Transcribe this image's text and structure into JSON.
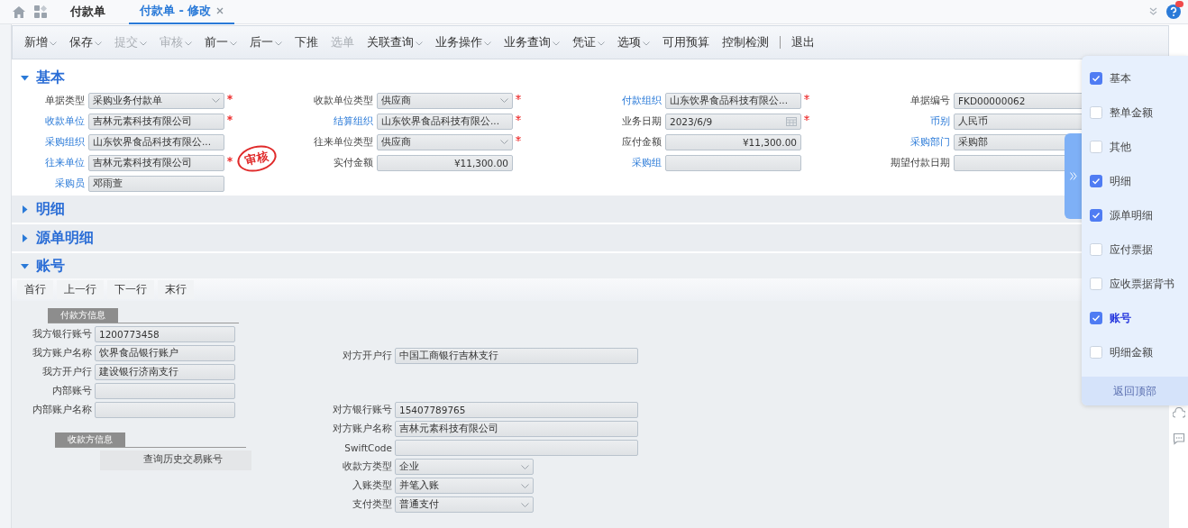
{
  "tabs": [
    {
      "label": "付款单",
      "selected": false,
      "closable": false
    },
    {
      "label": "付款单 - 修改",
      "selected": true,
      "closable": true
    }
  ],
  "toolbar": [
    {
      "kind": "item",
      "label": "新增",
      "menu": true,
      "disabled": false
    },
    {
      "kind": "item",
      "label": "保存",
      "menu": true,
      "disabled": false
    },
    {
      "kind": "item",
      "label": "提交",
      "menu": true,
      "disabled": true
    },
    {
      "kind": "item",
      "label": "审核",
      "menu": true,
      "disabled": true
    },
    {
      "kind": "item",
      "label": "前一",
      "menu": true,
      "disabled": false
    },
    {
      "kind": "item",
      "label": "后一",
      "menu": true,
      "disabled": false
    },
    {
      "kind": "item",
      "label": "下推",
      "menu": false,
      "disabled": false
    },
    {
      "kind": "item",
      "label": "选单",
      "menu": false,
      "disabled": true
    },
    {
      "kind": "item",
      "label": "关联查询",
      "menu": true,
      "disabled": false
    },
    {
      "kind": "item",
      "label": "业务操作",
      "menu": true,
      "disabled": false
    },
    {
      "kind": "item",
      "label": "业务查询",
      "menu": true,
      "disabled": false
    },
    {
      "kind": "item",
      "label": "凭证",
      "menu": true,
      "disabled": false
    },
    {
      "kind": "item",
      "label": "选项",
      "menu": true,
      "disabled": false
    },
    {
      "kind": "item",
      "label": "可用预算",
      "menu": false,
      "disabled": false
    },
    {
      "kind": "item",
      "label": "控制检测",
      "menu": false,
      "disabled": false
    },
    {
      "kind": "separator"
    },
    {
      "kind": "item",
      "label": "退出",
      "menu": false,
      "disabled": false
    }
  ],
  "sections": [
    {
      "kind": "form",
      "title": "基本",
      "expanded": true,
      "stamp": "审核",
      "rows": [
        [
          {
            "label": "单据类型",
            "value": "采购业务付款单",
            "kind": "select",
            "link": false,
            "required": true
          },
          {
            "label": "收款单位类型",
            "value": "供应商",
            "kind": "select",
            "link": false,
            "required": true
          },
          {
            "label": "付款组织",
            "value": "山东饮界食品科技有限公...",
            "kind": "text",
            "link": true,
            "required": true
          },
          {
            "label": "单据编号",
            "value": "FKD00000062",
            "kind": "text",
            "link": false,
            "required": false
          }
        ],
        [
          {
            "label": "收款单位",
            "value": "吉林元素科技有限公司",
            "kind": "text",
            "link": true,
            "required": true
          },
          {
            "label": "结算组织",
            "value": "山东饮界食品科技有限公...",
            "kind": "text",
            "link": true,
            "required": true
          },
          {
            "label": "业务日期",
            "value": "2023/6/9",
            "kind": "date",
            "link": false,
            "required": true
          },
          {
            "label": "币别",
            "value": "人民币",
            "kind": "text",
            "link": true,
            "required": false
          }
        ],
        [
          {
            "label": "采购组织",
            "value": "山东饮界食品科技有限公...",
            "kind": "text",
            "link": true,
            "required": false
          },
          {
            "label": "往来单位类型",
            "value": "供应商",
            "kind": "select",
            "link": false,
            "required": true
          },
          {
            "label": "应付金额",
            "value": "¥11,300.00",
            "kind": "amount",
            "link": false,
            "required": false
          },
          {
            "label": "采购部门",
            "value": "采购部",
            "kind": "text",
            "link": true,
            "required": false
          }
        ],
        [
          {
            "label": "往来单位",
            "value": "吉林元素科技有限公司",
            "kind": "text",
            "link": true,
            "required": true
          },
          {
            "label": "实付金额",
            "value": "¥11,300.00",
            "kind": "amount",
            "link": false,
            "required": false
          },
          {
            "label": "采购组",
            "kind": "text",
            "link": true,
            "required": false
          },
          {
            "label": "期望付款日期",
            "kind": "text",
            "link": false,
            "required": false
          }
        ],
        [
          {
            "label": "采购员",
            "value": "邓雨萱",
            "kind": "text",
            "link": true,
            "required": false
          }
        ]
      ]
    },
    {
      "kind": "detail",
      "title": "明细",
      "expanded": false
    },
    {
      "kind": "detail",
      "title": "源单明细",
      "expanded": false
    },
    {
      "kind": "account",
      "title": "账号",
      "expanded": true,
      "nav_buttons": [
        "首行",
        "上一行",
        "下一行",
        "末行"
      ],
      "payer": {
        "title": "付款方信息",
        "fields": [
          {
            "label": "我方银行账号",
            "value": "1200773458",
            "link": true
          },
          {
            "label": "我方账户名称",
            "value": "饮界食品银行账户",
            "link": false
          },
          {
            "label": "我方开户行",
            "value": "建设银行济南支行",
            "link": false
          },
          {
            "label": "内部账号",
            "link": true
          },
          {
            "label": "内部账户名称",
            "link": false
          }
        ]
      },
      "payee": {
        "title": "收款方信息",
        "button": "查询历史交易账号"
      },
      "counterparty": [
        {
          "label": "对方开户行",
          "value": "中国工商银行吉林支行",
          "kind": "text",
          "link": false
        },
        {
          "label": "对方银行账号",
          "value": "15407789765",
          "kind": "text",
          "link": false
        },
        {
          "label": "对方账户名称",
          "value": "吉林元素科技有限公司",
          "kind": "text",
          "link": false
        },
        {
          "label": "SwiftCode",
          "kind": "text",
          "link": false
        },
        {
          "label": "收款方类型",
          "value": "企业",
          "kind": "select",
          "link": false
        },
        {
          "label": "入账类型",
          "value": "并笔入账",
          "kind": "select",
          "link": false
        },
        {
          "label": "支付类型",
          "value": "普通支付",
          "kind": "select",
          "link": false
        }
      ]
    }
  ],
  "nav_panel": {
    "items": [
      {
        "label": "基本",
        "checked": true,
        "selected": false
      },
      {
        "label": "整单金额",
        "checked": false,
        "selected": false
      },
      {
        "label": "其他",
        "checked": false,
        "selected": false
      },
      {
        "label": "明细",
        "checked": true,
        "selected": false
      },
      {
        "label": "源单明细",
        "checked": true,
        "selected": false
      },
      {
        "label": "应付票据",
        "checked": false,
        "selected": false
      },
      {
        "label": "应收票据背书",
        "checked": false,
        "selected": false
      },
      {
        "label": "账号",
        "checked": true,
        "selected": true
      },
      {
        "label": "明细金额",
        "checked": false,
        "selected": false
      }
    ],
    "back_to_top": "返回顶部"
  }
}
